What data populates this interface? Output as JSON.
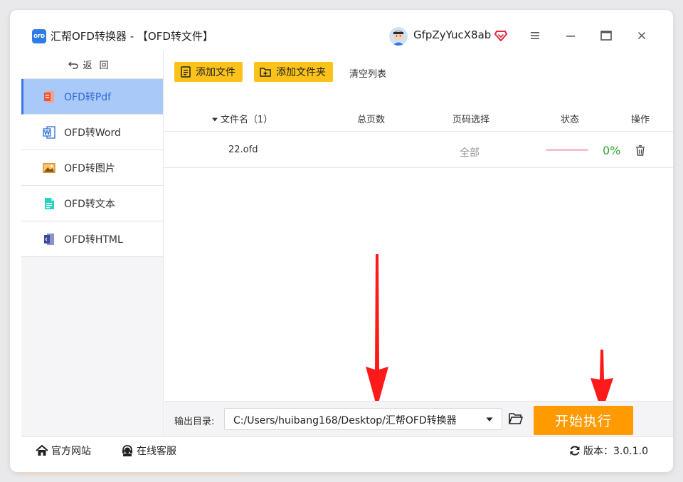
{
  "app": {
    "logo_text": "OFD",
    "title": "汇帮OFD转换器 - 【OFD转文件】",
    "username": "GfpZyYucX8ab"
  },
  "sidebar": {
    "back": "返回",
    "items": [
      {
        "label": "OFD转Pdf",
        "icon": "pdf-icon",
        "active": true
      },
      {
        "label": "OFD转Word",
        "icon": "word-icon",
        "active": false
      },
      {
        "label": "OFD转图片",
        "icon": "image-icon",
        "active": false
      },
      {
        "label": "OFD转文本",
        "icon": "text-icon",
        "active": false
      },
      {
        "label": "OFD转HTML",
        "icon": "html-icon",
        "active": false
      }
    ]
  },
  "toolbar": {
    "add_file": "添加文件",
    "add_folder": "添加文件夹",
    "clear": "清空列表"
  },
  "table": {
    "headers": {
      "name": "文件名（1）",
      "pages": "总页数",
      "range": "页码选择",
      "status": "状态",
      "action": "操作"
    },
    "rows": [
      {
        "name": "22.ofd",
        "pages": "",
        "range": "全部",
        "progress": 0,
        "percent": "0%"
      }
    ]
  },
  "output": {
    "label": "输出目录:",
    "path": "C:/Users/huibang168/Desktop/汇帮OFD转换器",
    "start": "开始执行"
  },
  "footer": {
    "website": "官方网站",
    "support": "在线客服",
    "version": "版本：3.0.1.0"
  },
  "colors": {
    "accent": "#fbc21a",
    "start": "#ff9a00",
    "active_nav": "#a9c9f8",
    "arrow": "#ff1a1a",
    "progress": "#2fa52f"
  }
}
